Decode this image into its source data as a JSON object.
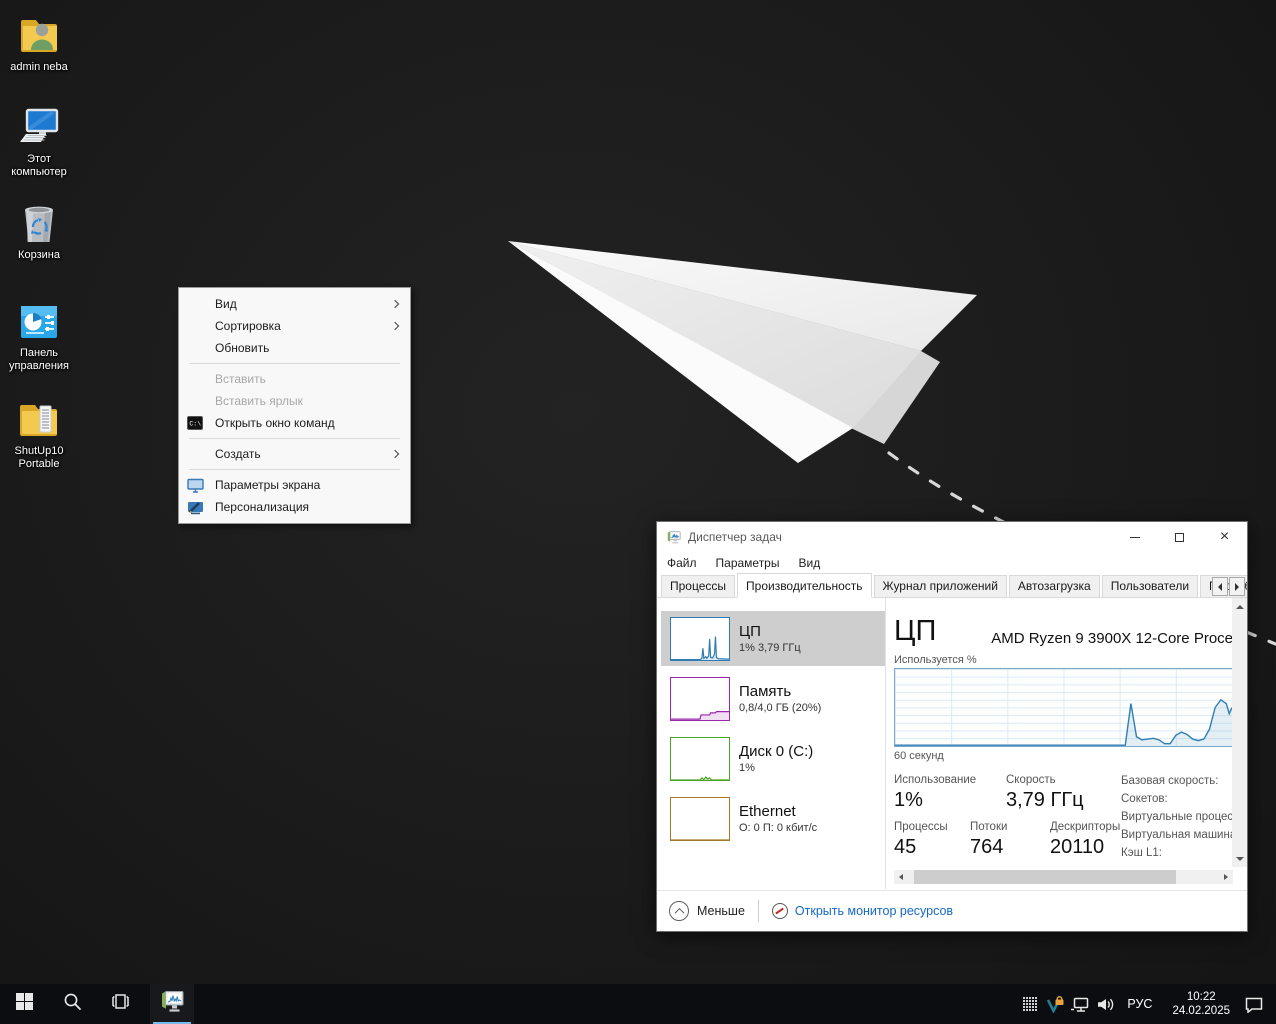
{
  "desktop": {
    "icons": [
      {
        "label": "admin neba",
        "icon": "user-folder"
      },
      {
        "label": "Этот компьютер",
        "icon": "computer"
      },
      {
        "label": "Корзина",
        "icon": "recycle-bin"
      },
      {
        "label": "Панель управления",
        "icon": "control-panel"
      },
      {
        "label": "ShutUp10 Portable",
        "icon": "folder-app"
      }
    ]
  },
  "context_menu": {
    "items": [
      {
        "label": "Вид",
        "submenu": true
      },
      {
        "label": "Сортировка",
        "submenu": true
      },
      {
        "label": "Обновить"
      },
      {
        "separator": true
      },
      {
        "label": "Вставить",
        "disabled": true
      },
      {
        "label": "Вставить ярлык",
        "disabled": true
      },
      {
        "label": "Открыть окно команд",
        "icon": "cmd"
      },
      {
        "separator": true
      },
      {
        "label": "Создать",
        "submenu": true
      },
      {
        "separator": true
      },
      {
        "label": "Параметры экрана",
        "icon": "display"
      },
      {
        "label": "Персонализация",
        "icon": "personalization"
      }
    ]
  },
  "task_manager": {
    "title": "Диспетчер задач",
    "menu": [
      "Файл",
      "Параметры",
      "Вид"
    ],
    "tabs": [
      "Процессы",
      "Производительность",
      "Журнал приложений",
      "Автозагрузка",
      "Пользователи",
      "Подробности"
    ],
    "active_tab": "Производительность",
    "sidebar": [
      {
        "name": "ЦП",
        "detail": "1% 3,79 ГГц",
        "color": "#2f7cb5",
        "selected": true,
        "spark": [
          [
            0,
            1
          ],
          [
            30,
            1
          ],
          [
            32,
            4
          ],
          [
            33,
            28
          ],
          [
            34,
            4
          ],
          [
            36,
            8
          ],
          [
            37,
            4
          ],
          [
            39,
            10
          ],
          [
            40,
            50
          ],
          [
            41,
            6
          ],
          [
            43,
            5
          ],
          [
            45,
            14
          ],
          [
            46,
            56
          ],
          [
            47,
            6
          ],
          [
            49,
            3
          ],
          [
            60,
            2
          ]
        ]
      },
      {
        "name": "Память",
        "detail": "0,8/4,0 ГБ (20%)",
        "color": "#9b27af",
        "selected": false,
        "spark": [
          [
            0,
            2
          ],
          [
            30,
            2
          ],
          [
            31,
            12
          ],
          [
            40,
            12
          ],
          [
            41,
            17
          ],
          [
            46,
            17
          ],
          [
            47,
            20
          ],
          [
            60,
            20
          ]
        ]
      },
      {
        "name": "Диск 0 (C:)",
        "detail": "1%",
        "color": "#4aa325",
        "selected": false,
        "spark": [
          [
            0,
            0
          ],
          [
            30,
            0
          ],
          [
            32,
            5
          ],
          [
            34,
            1
          ],
          [
            36,
            7
          ],
          [
            38,
            2
          ],
          [
            40,
            5
          ],
          [
            42,
            0
          ],
          [
            60,
            0
          ]
        ]
      },
      {
        "name": "Ethernet",
        "detail": "О: 0 П: 0 кбит/с",
        "color": "#a6762a",
        "selected": false,
        "spark": [
          [
            0,
            0
          ],
          [
            60,
            0
          ]
        ]
      }
    ],
    "main": {
      "heading": "ЦП",
      "cpu_name": "AMD Ryzen 9 3900X 12-Core Proce",
      "chart_top_label": "Используется %",
      "chart_bottom_label": "60 секунд",
      "stats_row1": [
        {
          "label": "Использование",
          "value": "1%"
        },
        {
          "label": "Скорость",
          "value": "3,79 ГГц"
        }
      ],
      "stats_row2": [
        {
          "label": "Процессы",
          "value": "45"
        },
        {
          "label": "Потоки",
          "value": "764"
        },
        {
          "label": "Дескрипторы",
          "value": "20110"
        }
      ],
      "info_labels": [
        "Базовая скорость:",
        "Сокетов:",
        "Виртуальные процессоры:",
        "Виртуальная машина:",
        "Кэш L1:"
      ]
    },
    "footer": {
      "less": "Меньше",
      "link": "Открыть монитор ресурсов"
    }
  },
  "taskbar": {
    "buttons": [
      {
        "icon": "start"
      },
      {
        "icon": "search"
      },
      {
        "icon": "task-view"
      }
    ],
    "app_buttons": [
      {
        "icon": "task-manager",
        "active": true
      }
    ],
    "tray_icons": [
      {
        "icon": "hidden-icons-grid"
      },
      {
        "icon": "veracrypt"
      },
      {
        "icon": "network"
      },
      {
        "icon": "volume"
      }
    ],
    "language": "РУС",
    "time": "10:22",
    "date": "24.02.2025"
  },
  "chart_data": {
    "type": "area",
    "title": "ЦП — Используется %",
    "ylabel": "Используется %",
    "xlabel": "60 секунд",
    "x_window_seconds": 60,
    "ylim": [
      0,
      100
    ],
    "grid": true,
    "series": [
      {
        "name": "ЦП",
        "points": [
          [
            0,
            1
          ],
          [
            38,
            1
          ],
          [
            41,
            1
          ],
          [
            42,
            55
          ],
          [
            43,
            12
          ],
          [
            44,
            8
          ],
          [
            45,
            9
          ],
          [
            46,
            10
          ],
          [
            47,
            8
          ],
          [
            48,
            3
          ],
          [
            49,
            3
          ],
          [
            50,
            14
          ],
          [
            51,
            18
          ],
          [
            52,
            15
          ],
          [
            53,
            9
          ],
          [
            54,
            7
          ],
          [
            55,
            9
          ],
          [
            56,
            22
          ],
          [
            57,
            50
          ],
          [
            58,
            60
          ],
          [
            59,
            55
          ],
          [
            59.5,
            42
          ],
          [
            60,
            50
          ]
        ]
      }
    ]
  }
}
